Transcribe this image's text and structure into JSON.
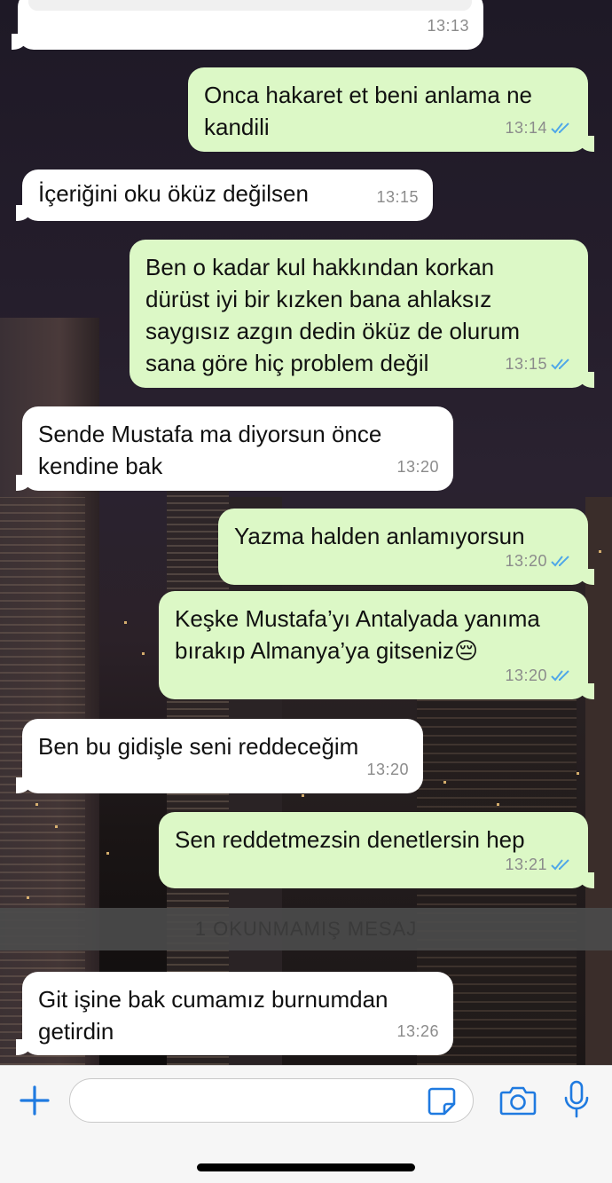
{
  "messages": [
    {
      "dir": "in",
      "text": "",
      "time": "13:13"
    },
    {
      "dir": "out",
      "text": "Onca hakaret et beni anlama ne\nkandili",
      "time": "13:14",
      "read": true
    },
    {
      "dir": "in",
      "text": "İçeriğini oku öküz değilsen",
      "time": "13:15"
    },
    {
      "dir": "out",
      "text": "Ben o kadar kul hakkından korkan\ndürüst iyi bir kızken bana ahlaksız\nsaygısız azgın dedin öküz de olurum\nsana göre hiç problem değil",
      "time": "13:15",
      "read": true
    },
    {
      "dir": "in",
      "text": "Sende Mustafa ma diyorsun önce\nkendine bak",
      "time": "13:20"
    },
    {
      "dir": "out",
      "text": "Yazma halden anlamıyorsun",
      "time": "13:20",
      "read": true
    },
    {
      "dir": "out",
      "text": "Keşke Mustafa’yı Antalyada yanıma\nbırakıp Almanya’ya gitseniz😔",
      "time": "13:20",
      "read": true
    },
    {
      "dir": "in",
      "text": "Ben bu gidişle seni reddeceğim",
      "time": "13:20"
    },
    {
      "dir": "out",
      "text": "Sen reddetmezsin denetlersin hep",
      "time": "13:21",
      "read": true
    },
    {
      "dir": "in",
      "text": "Git işine bak cumamız burnumdan\ngetirdin",
      "time": "13:26"
    }
  ],
  "unread_banner": "1 OKUNMAMIŞ MESAJ",
  "input": {
    "placeholder": "",
    "value": ""
  },
  "icons": {
    "add": "plus-icon",
    "sticker": "sticker-icon",
    "camera": "camera-icon",
    "mic": "microphone-icon",
    "ticks": "double-check-icon"
  },
  "colors": {
    "accent": "#1f7ae0",
    "outgoing": "#dcf8c6",
    "incoming": "#ffffff",
    "read_ticks": "#4fa7e8"
  }
}
